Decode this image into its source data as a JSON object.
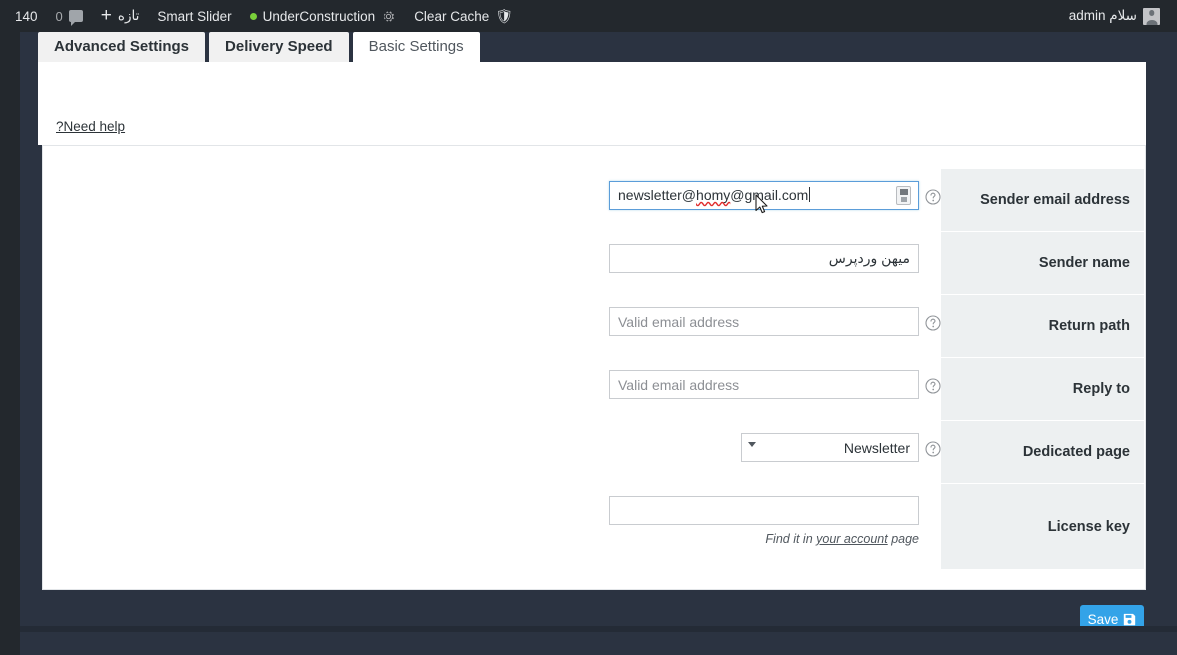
{
  "adminbar": {
    "greeting": "سلام admin",
    "avatar_icon": "user-avatar-icon",
    "items_left": [
      {
        "label": "Clear Cache",
        "icon": "shield-cache-icon"
      },
      {
        "label": "UnderConstruction",
        "icon": "gear-icon"
      },
      {
        "label": "Smart Slider",
        "icon": ""
      },
      {
        "label": "تازه",
        "icon": "plus-icon"
      }
    ],
    "comment_count": "0",
    "notification_count": "140"
  },
  "tabs": [
    {
      "label": "Basic Settings",
      "active": true
    },
    {
      "label": "Delivery Speed",
      "active": false
    },
    {
      "label": "Advanced Settings",
      "active": false
    }
  ],
  "header": {
    "need_help": "?Need help"
  },
  "form": {
    "rows": [
      {
        "label": "Sender email address",
        "type": "email-focused",
        "value_prefix": "newsletter@",
        "value_misspelled": "homy",
        "value_suffix": "@gmail.com",
        "value_full": "newsletter@homy@gmail.com",
        "has_help": true,
        "inline_icon": "contact-card-icon"
      },
      {
        "label": "Sender name",
        "type": "text-rtl",
        "value": "میهن وردپرس",
        "placeholder": "",
        "has_help": false
      },
      {
        "label": "Return path",
        "type": "text",
        "value": "",
        "placeholder": "Valid email address",
        "has_help": true
      },
      {
        "label": "Reply to",
        "type": "text",
        "value": "",
        "placeholder": "Valid email address",
        "has_help": true
      },
      {
        "label": "Dedicated page",
        "type": "select",
        "selected": "Newsletter",
        "options": [
          "Newsletter"
        ],
        "has_help": true
      },
      {
        "label": "License key",
        "type": "text-hint",
        "value": "",
        "placeholder": "",
        "has_help": false,
        "hint_before": "Find it in ",
        "hint_link": "your account",
        "hint_after": " page"
      }
    ]
  },
  "footer": {
    "save_label": "Save",
    "save_icon": "floppy-save-icon",
    "save_color": "#33a3e8"
  },
  "colors": {
    "page_background": "#2b3341",
    "rail": "#23282d",
    "adminbar": "#23282d",
    "label_cell": "#edf0f1",
    "accent": "#33a3e8",
    "focus_border": "#5b9dd9",
    "spellcheck": "#e02b2b"
  }
}
